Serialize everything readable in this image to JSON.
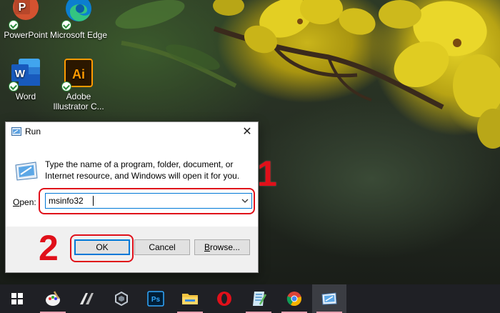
{
  "desktop": {
    "icons": [
      {
        "label": "PowerPoint",
        "letter": "P"
      },
      {
        "label": "Microsoft Edge"
      },
      {
        "label": "Word",
        "letter": "W"
      },
      {
        "label": "Adobe Illustrator C...",
        "letter": "Ai"
      }
    ]
  },
  "run_dialog": {
    "title": "Run",
    "description": "Type the name of a program, folder, document, or Internet resource, and Windows will open it for you.",
    "open_label_accel": "O",
    "open_label_rest": "pen:",
    "open_value": "msinfo32",
    "buttons": {
      "ok": "OK",
      "cancel": "Cancel",
      "browse_accel": "B",
      "browse_rest": "rowse..."
    }
  },
  "annotations": {
    "step1": "1",
    "step2": "2"
  },
  "taskbar": {
    "photoshop_label": "Ps",
    "items": [
      "start-icon",
      "paint-icon",
      "aspen-icon",
      "unity-icon",
      "photoshop-icon",
      "file-explorer-icon",
      "opera-icon",
      "notepad-icon",
      "chrome-icon",
      "run-app-icon"
    ]
  },
  "colors": {
    "annotation_red": "#e0101a",
    "dialog_accent": "#0078d7",
    "taskbar": "#1f2025"
  }
}
